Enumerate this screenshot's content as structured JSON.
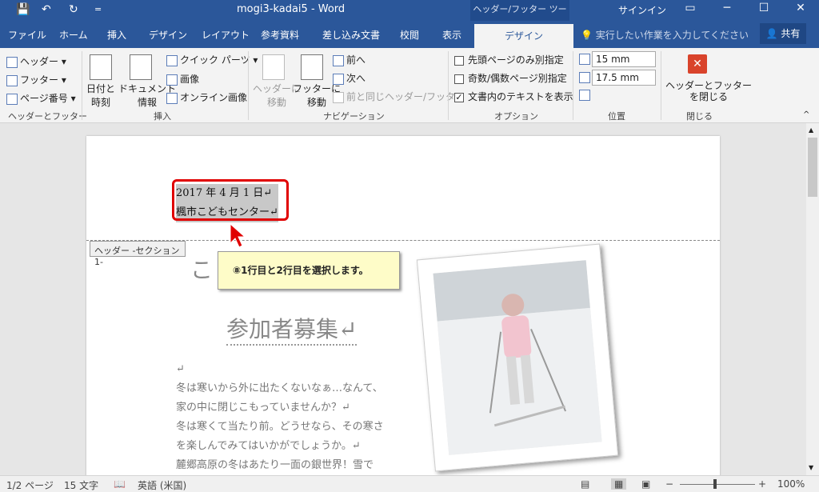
{
  "titlebar": {
    "title": "mogi3-kadai5  -  Word",
    "context_tab": "ヘッダー/フッター ツール",
    "signin": "サインイン",
    "minimize": "─",
    "maximize": "☐",
    "close": "✕",
    "save": "💾",
    "undo": "↶",
    "redo": "↻",
    "customize": "="
  },
  "tabs": [
    "ファイル",
    "ホーム",
    "挿入",
    "デザイン",
    "レイアウト",
    "参考資料",
    "差し込み文書",
    "校閲",
    "表示",
    "デザイン"
  ],
  "tellme": "実行したい作業を入力してください",
  "share": "共有",
  "ribbon": {
    "header": "ヘッダー",
    "footer": "フッター",
    "page_number": "ページ番号",
    "group1": "ヘッダーとフッター",
    "datetime": "日付と\n時刻",
    "docinfo": "ドキュメント\n情報",
    "quickparts": "クイック パーツ",
    "picture": "画像",
    "online_picture": "オンライン画像",
    "group2": "挿入",
    "goto_header": "ヘッダーに\n移動",
    "goto_footer": "フッターに\n移動",
    "prev": "前へ",
    "next": "次へ",
    "link_prev": "前と同じヘッダー/フッター",
    "group3": "ナビゲーション",
    "opt1": "先頭ページのみ別指定",
    "opt2": "奇数/偶数ページ別指定",
    "opt3": "文書内のテキストを表示",
    "group4": "オプション",
    "header_pos": "15 mm",
    "footer_pos": "17.5 mm",
    "group5": "位置",
    "close": "ヘッダーとフッター\nを閉じる",
    "group6": "閉じる"
  },
  "doc": {
    "header_line1": "2017 年 4 月 1 日↵",
    "header_line2": "楓市こどもセンター↵",
    "header_tag": "ヘッダー -セクション 1-",
    "callout": "⑧1行目と2行目を選択します。",
    "heading1": "こ",
    "heading2": "参加者募集↵",
    "body": [
      "↵",
      "冬は寒いから外に出たくないなぁ…なんて、",
      "家の中に閉じこもっていませんか？↵",
      "冬は寒くて当たり前。どうせなら、その寒さ",
      "を楽しんでみてはいかがでしょうか。↵",
      "麓郷高原の冬はあたり一面の銀世界！雪で"
    ]
  },
  "status": {
    "page": "1/2 ページ",
    "words": "15 文字",
    "lang": "英語 (米国)",
    "zoom": "100%"
  },
  "colors": {
    "accent": "#2b579a",
    "highlight_box": "#e00000",
    "callout_bg": "#fefcc8"
  }
}
